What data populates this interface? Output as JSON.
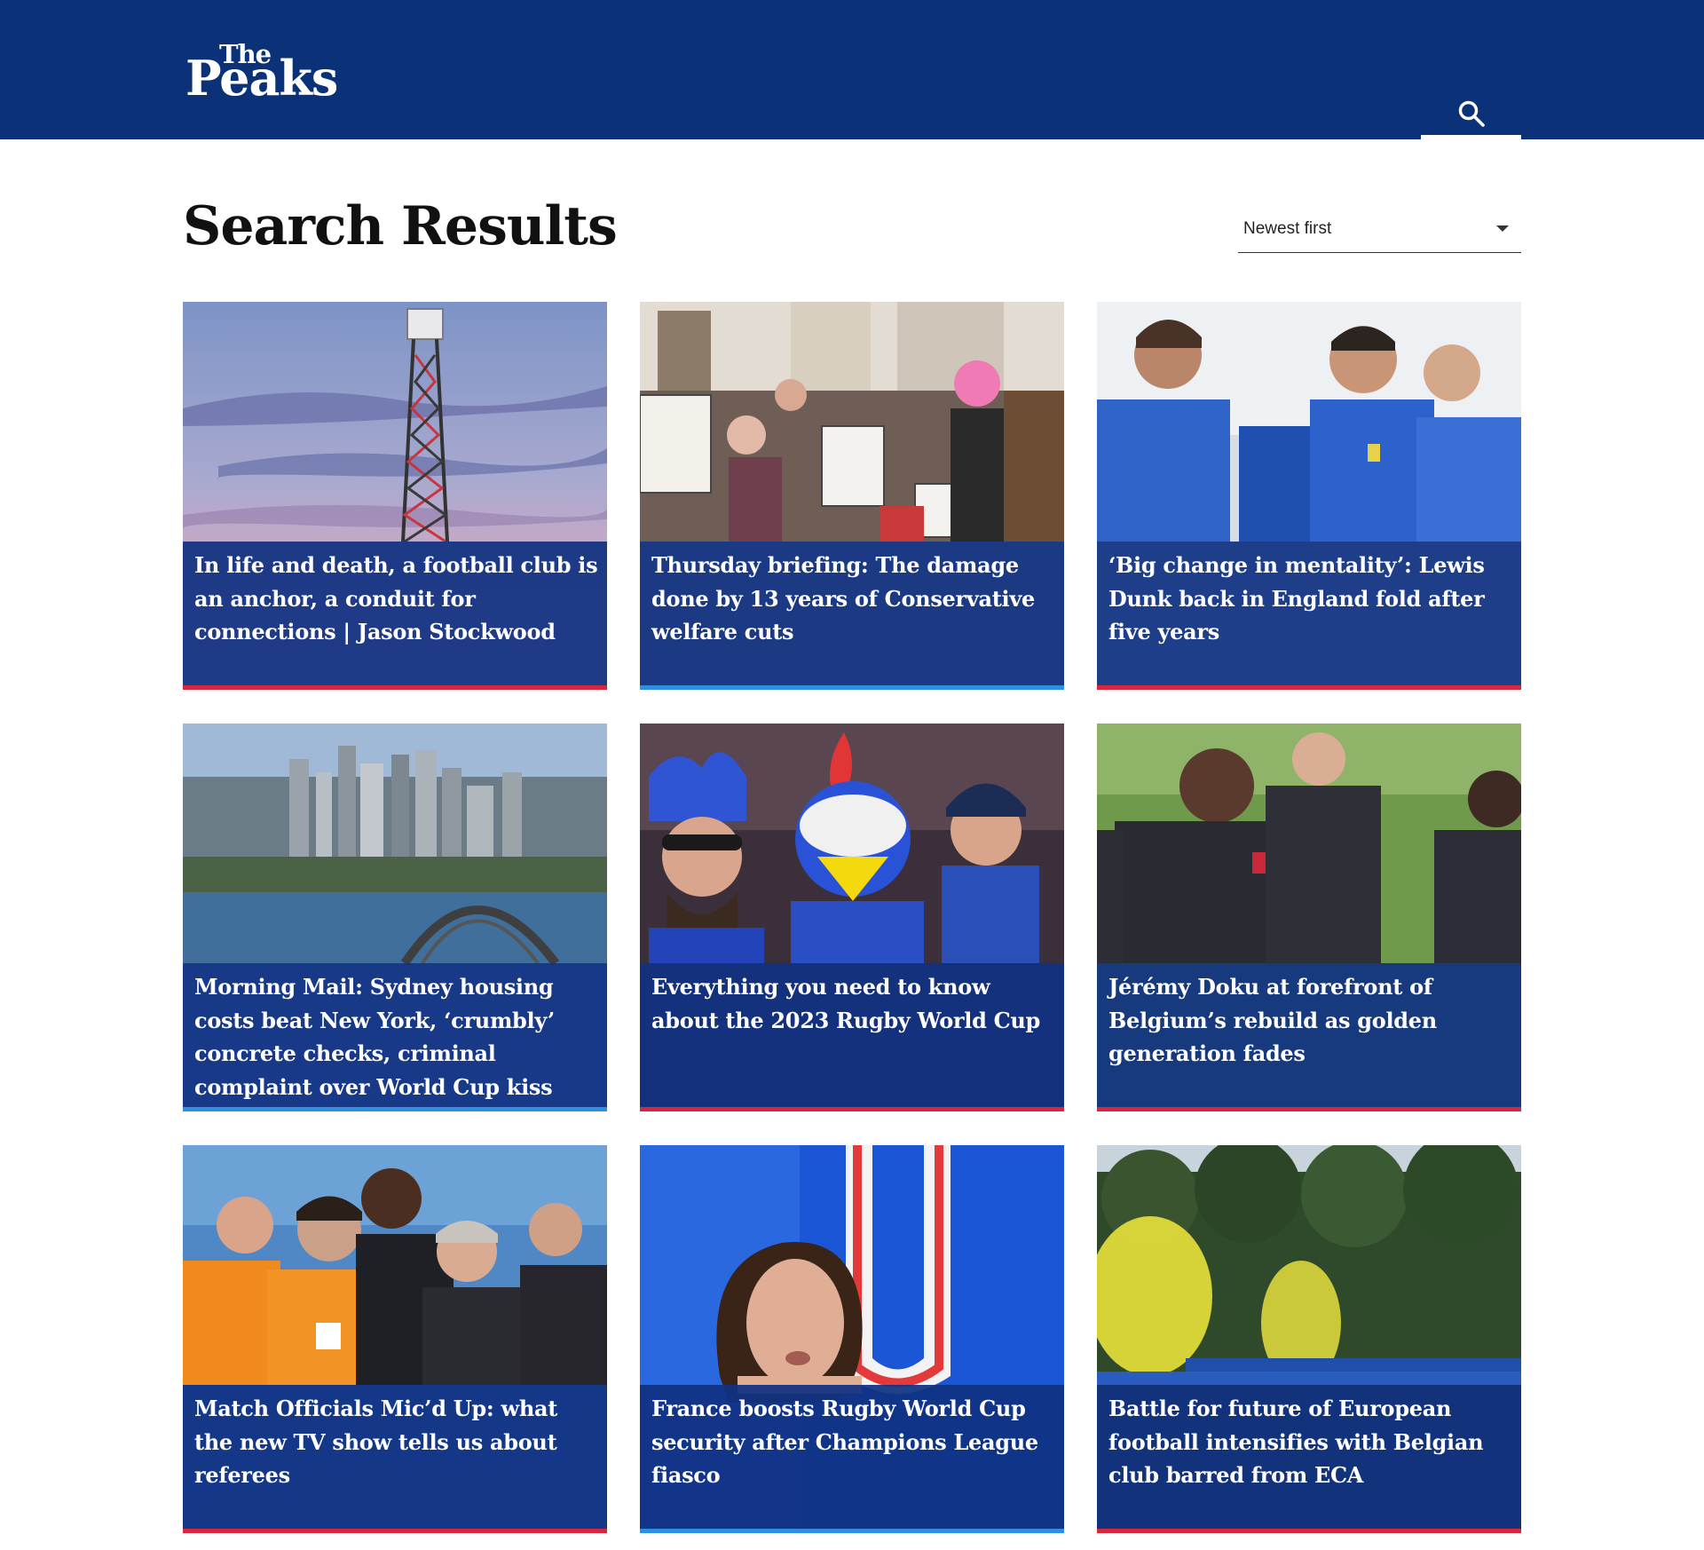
{
  "brand": {
    "logo_line1": "The",
    "logo_line2": "Peaks",
    "header_bg": "#0b3278"
  },
  "header": {
    "search_icon": "search-icon"
  },
  "page": {
    "title": "Search Results"
  },
  "sort": {
    "selected": "Newest first"
  },
  "cards": [
    {
      "headline": "In life and death, a football club is an anchor, a conduit for connections | Jason Stockwood",
      "bar_color": "#d7263d"
    },
    {
      "headline": "Thursday briefing: The damage done by 13 years of Conservative welfare cuts",
      "bar_color": "#2f8fe0"
    },
    {
      "headline": "‘Big change in mentality’: Lewis Dunk back in England fold after five years",
      "bar_color": "#d7263d"
    },
    {
      "headline": "Morning Mail: Sydney housing costs beat New York, ‘crumbly’ concrete checks, criminal complaint over World Cup kiss",
      "bar_color": "#2f8fe0"
    },
    {
      "headline": "Everything you need to know about the 2023 Rugby World Cup",
      "bar_color": "#d7263d"
    },
    {
      "headline": "Jérémy Doku at forefront of Belgium’s rebuild as golden generation fades",
      "bar_color": "#d7263d"
    },
    {
      "headline": "Match Officials Mic’d Up: what the new TV show tells us about referees",
      "bar_color": "#d7263d"
    },
    {
      "headline": "France boosts Rugby World Cup security after Champions League fiasco",
      "bar_color": "#2f8fe0"
    },
    {
      "headline": "Battle for future of European football intensifies with Belgian club barred from ECA",
      "bar_color": "#d7263d"
    }
  ]
}
